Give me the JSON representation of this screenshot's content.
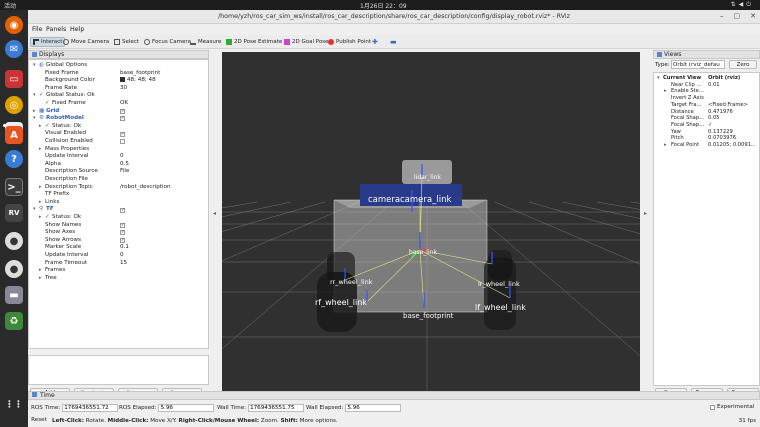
{
  "system": {
    "activities": "活动",
    "clock": "1月26日 22：09"
  },
  "window": {
    "title": "/home/yzh/ros_car_sim_ws/install/ros_car_description/share/ros_car_description/config/display_robot.rviz* - RViz",
    "tab_label": "rviz2"
  },
  "menu": [
    "File",
    "Panels",
    "Help"
  ],
  "toolbar": [
    {
      "label": "Interact",
      "icon": "cursor-icon"
    },
    {
      "label": "Move Camera",
      "icon": "move-camera-icon"
    },
    {
      "label": "Select",
      "icon": "select-icon"
    },
    {
      "label": "Focus Camera",
      "icon": "focus-camera-icon"
    },
    {
      "label": "Measure",
      "icon": "ruler-icon"
    },
    {
      "label": "2D Pose Estimate",
      "icon": "green-arrow-icon"
    },
    {
      "label": "2D Goal Pose",
      "icon": "pink-arrow-icon"
    },
    {
      "label": "Publish Point",
      "icon": "pin-icon"
    }
  ],
  "displays": {
    "title": "Displays",
    "rows": [
      {
        "k": "Global Options",
        "v": "",
        "d": 1,
        "a": "▾",
        "t": "gear"
      },
      {
        "k": "Fixed Frame",
        "v": "base_footprint",
        "d": 2
      },
      {
        "k": "Background Color",
        "v": "48; 48; 48",
        "d": 2,
        "sw": true
      },
      {
        "k": "Frame Rate",
        "v": "30",
        "d": 2
      },
      {
        "k": "Global Status: Ok",
        "v": "",
        "d": 1,
        "a": "▾",
        "t": "ok"
      },
      {
        "k": "Fixed Frame",
        "v": "OK",
        "d": 2,
        "t": "ok"
      },
      {
        "k": "Grid",
        "v": "",
        "d": 1,
        "a": "▸",
        "t": "grid",
        "c": true,
        "blue": true
      },
      {
        "k": "RobotModel",
        "v": "",
        "d": 1,
        "a": "▾",
        "t": "robot",
        "c": true,
        "blue": true
      },
      {
        "k": "Status: Ok",
        "v": "",
        "d": 2,
        "a": "▸",
        "t": "ok"
      },
      {
        "k": "Visual Enabled",
        "v": "",
        "d": 2,
        "c": true
      },
      {
        "k": "Collision Enabled",
        "v": "",
        "d": 2,
        "c": false
      },
      {
        "k": "Mass Properties",
        "v": "",
        "d": 2,
        "a": "▸"
      },
      {
        "k": "Update Interval",
        "v": "0",
        "d": 2
      },
      {
        "k": "Alpha",
        "v": "0.5",
        "d": 2
      },
      {
        "k": "Description Source",
        "v": "File",
        "d": 2
      },
      {
        "k": "Description File",
        "v": "",
        "d": 2
      },
      {
        "k": "Description Topic",
        "v": "/robot_description",
        "d": 2,
        "a": "▸"
      },
      {
        "k": "TF Prefix",
        "v": "",
        "d": 2
      },
      {
        "k": "Links",
        "v": "",
        "d": 2,
        "a": "▸"
      },
      {
        "k": "TF",
        "v": "",
        "d": 1,
        "a": "▾",
        "t": "tf",
        "c": true,
        "blue": true
      },
      {
        "k": "Status: Ok",
        "v": "",
        "d": 2,
        "a": "▸",
        "t": "ok"
      },
      {
        "k": "Show Names",
        "v": "",
        "d": 2,
        "c": true
      },
      {
        "k": "Show Axes",
        "v": "",
        "d": 2,
        "c": true
      },
      {
        "k": "Show Arrows",
        "v": "",
        "d": 2,
        "c": true
      },
      {
        "k": "Marker Scale",
        "v": "0.1",
        "d": 2
      },
      {
        "k": "Update Interval",
        "v": "0",
        "d": 2
      },
      {
        "k": "Frame Timeout",
        "v": "15",
        "d": 2
      },
      {
        "k": "Frames",
        "v": "",
        "d": 2,
        "a": "▸"
      },
      {
        "k": "Tree",
        "v": "",
        "d": 2,
        "a": "▸"
      }
    ],
    "buttons": [
      {
        "label": "Add",
        "disabled": false
      },
      {
        "label": "Duplicate",
        "disabled": true
      },
      {
        "label": "Remove",
        "disabled": true
      },
      {
        "label": "Rename",
        "disabled": true
      }
    ]
  },
  "scene": {
    "labels": {
      "lidar": "lidar_link",
      "camera": "camera",
      "camera_overlap": "camera_link",
      "base_link": "base_link",
      "rr": "rr_wheel_link",
      "rf": "rf_wheel_link",
      "lr": "lr_wheel_link",
      "lf": "lf_wheel_link",
      "footprint": "base_footprint"
    }
  },
  "views": {
    "title": "Views",
    "type_label": "Type:",
    "type_value": "Orbit (rviz_defau",
    "zero": "Zero",
    "rows": [
      {
        "k": "Current View",
        "v": "Orbit (rviz)",
        "bold": true,
        "a": "▾"
      },
      {
        "k": "Near Clip ...",
        "v": "0.01"
      },
      {
        "k": "Enable Ste...",
        "v": "",
        "a": "▸"
      },
      {
        "k": "Invert Z Axis",
        "v": ""
      },
      {
        "k": "Target Fra...",
        "v": "<Fixed Frame>"
      },
      {
        "k": "Distance",
        "v": "0.471976"
      },
      {
        "k": "Focal Shap...",
        "v": "0.05"
      },
      {
        "k": "Focal Shap...",
        "v": "✓"
      },
      {
        "k": "Yaw",
        "v": "0.137229"
      },
      {
        "k": "Pitch",
        "v": "0.0703976"
      },
      {
        "k": "Focal Point",
        "v": "0.01205; 0.0091...",
        "a": "▸"
      }
    ],
    "buttons": [
      "Save",
      "Remove",
      "Rename"
    ]
  },
  "time": {
    "title": "Time",
    "ros_time_label": "ROS Time:",
    "ros_time": "1769436551.72",
    "ros_elapsed_label": "ROS Elapsed:",
    "ros_elapsed": "5.96",
    "wall_time_label": "Wall Time:",
    "wall_time": "1769436551.75",
    "wall_elapsed_label": "Wall Elapsed:",
    "wall_elapsed": "5.96",
    "experimental": "Experimental"
  },
  "status": {
    "reset": "Reset",
    "hint_b1": "Left-Click:",
    "hint_t1": " Rotate. ",
    "hint_b2": "Middle-Click:",
    "hint_t2": " Move X/Y. ",
    "hint_b3": "Right-Click/Mouse Wheel:",
    "hint_t3": " Zoom. ",
    "hint_b4": "Shift:",
    "hint_t4": " More options.",
    "fps": "31 fps"
  },
  "colors": {
    "background": "#303030",
    "grid": "#a0a0a0",
    "chassis": "#c8c8c8",
    "camera": "#2a3a8a",
    "lidar": "#9a9a9a",
    "wheel": "#1a1a1a",
    "ubuntu_orange": "#e95420"
  }
}
